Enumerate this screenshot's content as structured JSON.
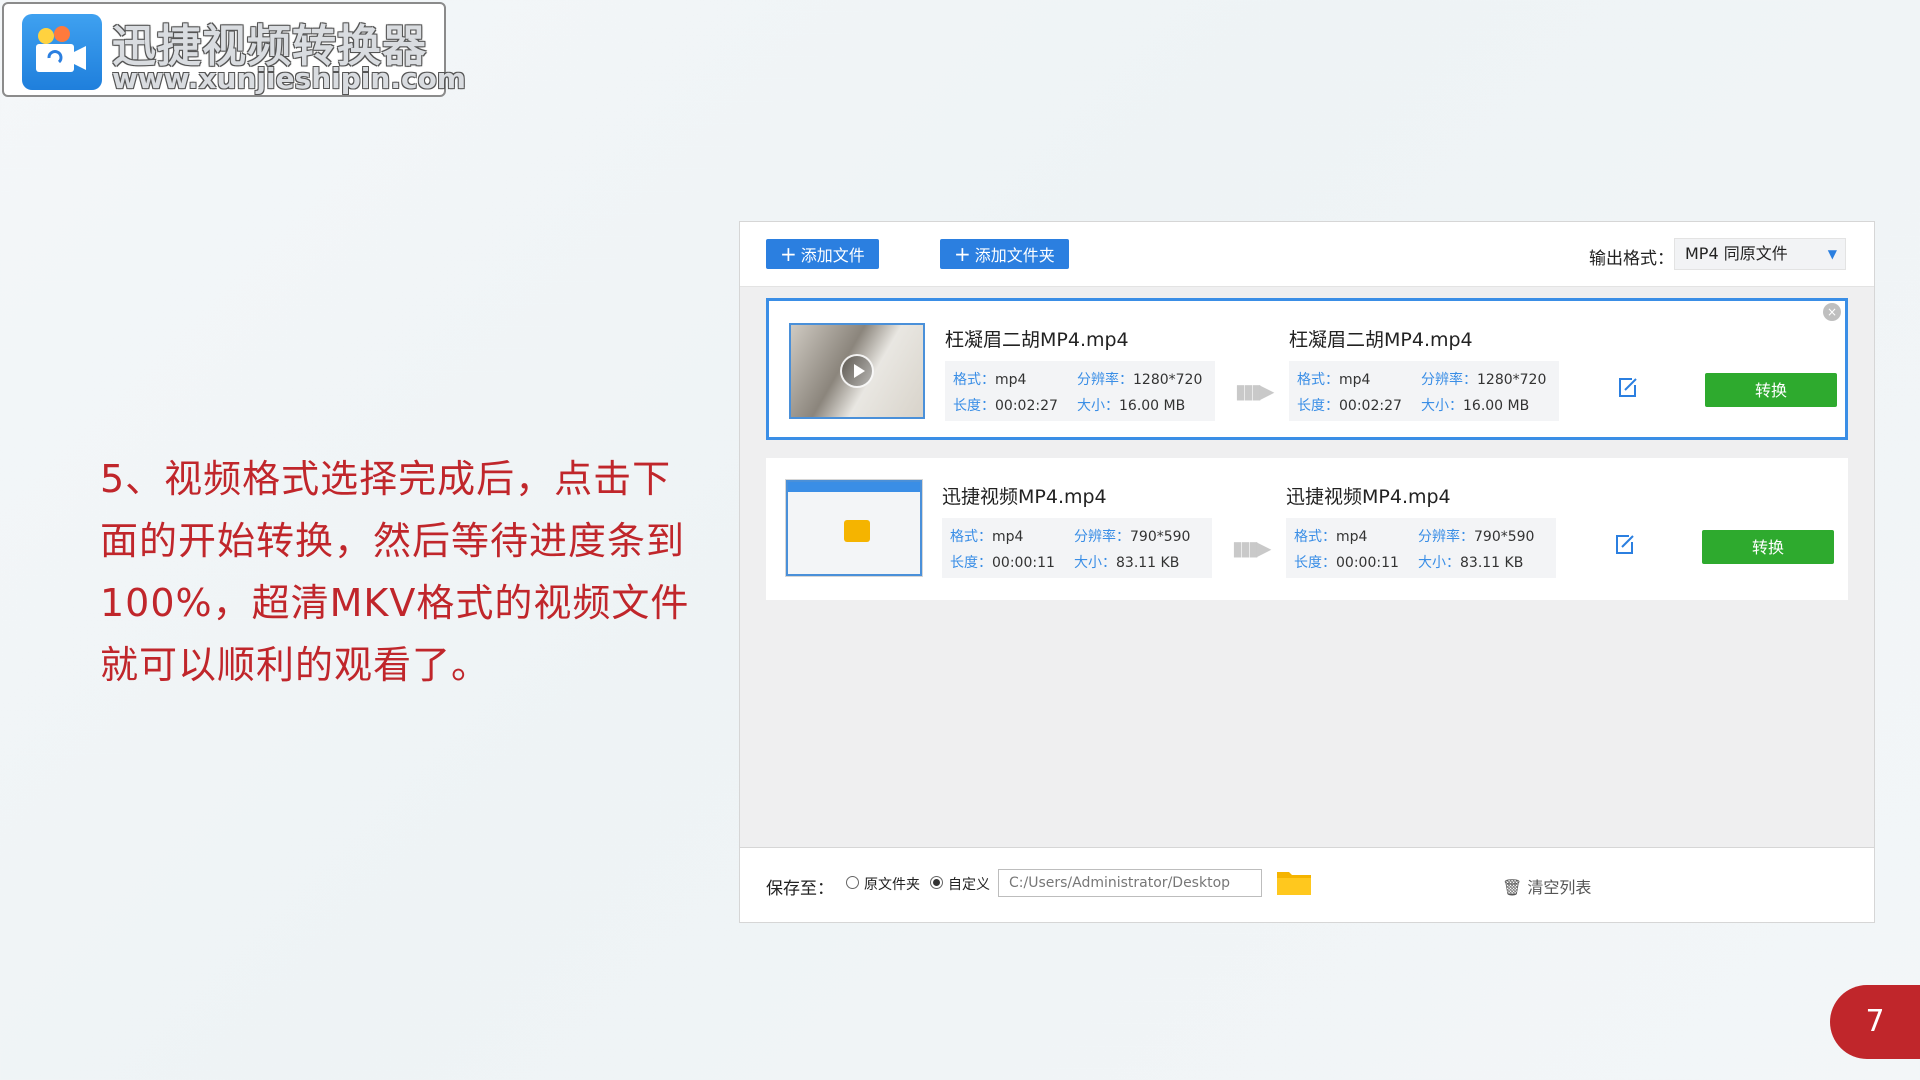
{
  "logo": {
    "title": "迅捷视频转换器",
    "url": "www.xunjieshipin.com"
  },
  "instruction": "5、视频格式选择完成后，点击下面的开始转换，然后等待进度条到100%，超清MKV格式的视频文件就可以顺利的观看了。",
  "toolbar": {
    "add_file": "添加文件",
    "add_folder": "添加文件夹",
    "output_label": "输出格式：",
    "output_value": "MP4 同原文件"
  },
  "files": [
    {
      "name": "枉凝眉二胡MP4.mp4",
      "out_name": "枉凝眉二胡MP4.mp4",
      "format": "mp4",
      "resolution": "1280*720",
      "duration": "00:02:27",
      "size": "16.00 MB",
      "convert": "转换"
    },
    {
      "name": "迅捷视频MP4.mp4",
      "out_name": "迅捷视频MP4.mp4",
      "format": "mp4",
      "resolution": "790*590",
      "duration": "00:00:11",
      "size": "83.11 KB",
      "convert": "转换"
    }
  ],
  "labels": {
    "format": "格式：",
    "resolution": "分辨率：",
    "duration": "长度：",
    "size": "大小："
  },
  "bottom": {
    "save_label": "保存至：",
    "opt_original": "原文件夹",
    "opt_custom": "自定义",
    "path": "C:/Users/Administrator/Desktop",
    "clear": "清空列表"
  },
  "page_number": "7",
  "colors": {
    "accent": "#2b7fe0",
    "convert": "#2eaa2e",
    "instruction": "#c0262b"
  }
}
